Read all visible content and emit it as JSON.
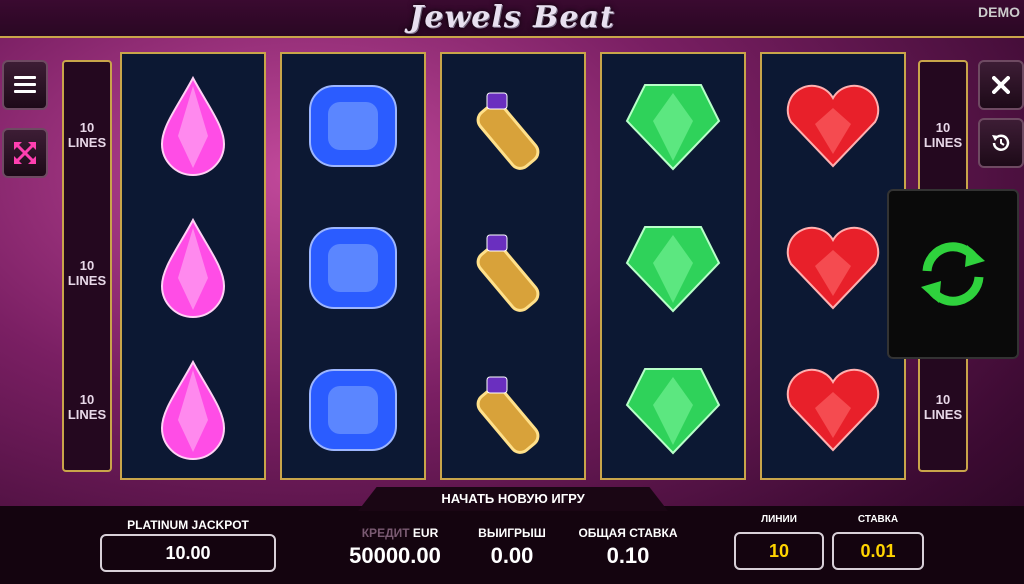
{
  "header": {
    "title": "Jewels Beat",
    "mode": "DEMO"
  },
  "lines_indicator": {
    "label_number": "10",
    "label_word": "LINES"
  },
  "reels": [
    {
      "symbol": "pink-gem",
      "color": "#ff4de6"
    },
    {
      "symbol": "blue-gem",
      "color": "#2b5cff"
    },
    {
      "symbol": "gold-ring",
      "color": "#d8a23a"
    },
    {
      "symbol": "green-gem",
      "color": "#2fd25a"
    },
    {
      "symbol": "red-heart",
      "color": "#e8202a"
    }
  ],
  "controls": {
    "menu_icon": "hamburger-icon",
    "fullscreen_icon": "fullscreen-icon",
    "close_icon": "close-icon",
    "history_icon": "history-icon",
    "spin_icon": "spin-icon",
    "spin_color": "#2fd23d"
  },
  "bottom": {
    "new_game": "НАЧАТЬ НОВУЮ ИГРУ",
    "jackpot_label": "PLATINUM JACKPOT",
    "jackpot_value": "10.00",
    "credit_label": "КРЕДИТ",
    "credit_currency": "EUR",
    "credit_value": "50000.00",
    "win_label": "ВЫИГРЫШ",
    "win_value": "0.00",
    "total_bet_label": "ОБЩАЯ СТАВКА",
    "total_bet_value": "0.10",
    "lines_label": "ЛИНИИ",
    "lines_value": "10",
    "bet_label": "СТАВКА",
    "bet_value": "0.01",
    "accent_color": "#ffd400"
  }
}
